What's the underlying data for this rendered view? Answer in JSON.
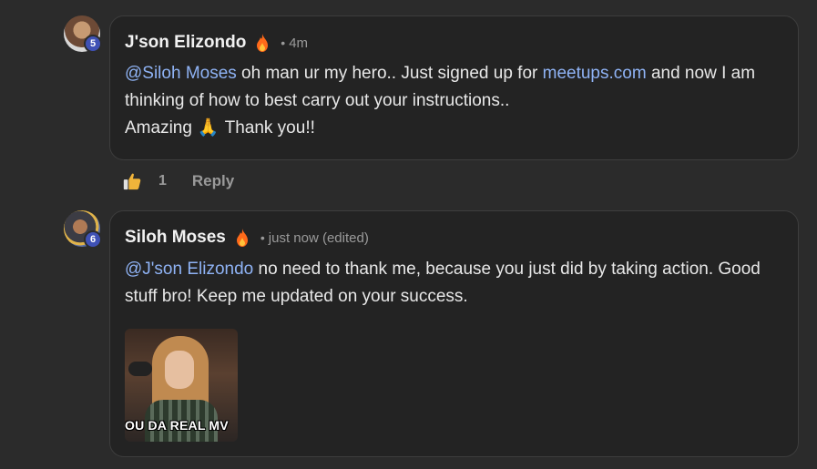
{
  "comments": [
    {
      "author": "J'son Elizondo",
      "level": "5",
      "time": "4m",
      "mention": "@Siloh Moses",
      "text_part1": " oh man ur my hero.. Just signed up for ",
      "link": "meetups.com",
      "text_part2": " and now I am thinking of how to best carry out your instructions..",
      "line2_a": "Amazing",
      "emoji": "🙏",
      "line2_b": "Thank you!!",
      "likes": "1",
      "reply_label": "Reply"
    },
    {
      "author": "Siloh Moses",
      "level": "6",
      "time": "just now (edited)",
      "mention": "@J'son Elizondo",
      "text": " no need to thank me, because you just did by taking action. Good stuff bro! Keep me updated on your success.",
      "gif_caption": "OU DA REAL MV"
    }
  ],
  "icons": {
    "flame": "flame-icon",
    "like": "thumbs-up-icon"
  },
  "colors": {
    "mention": "#8fb3f5",
    "level_badge": "#3f51b5",
    "flame": "#ff6a1a"
  }
}
